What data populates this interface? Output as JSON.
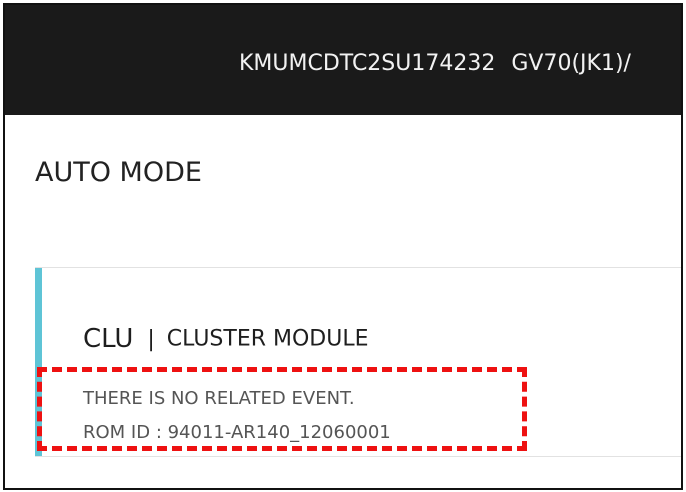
{
  "header": {
    "vin": "KMUMCDTC2SU174232",
    "model": "GV70(JK1)/"
  },
  "mode": {
    "title": "AUTO MODE"
  },
  "module": {
    "code": "CLU",
    "separator": "|",
    "name": "CLUSTER MODULE",
    "event_status": "THERE IS NO RELATED EVENT.",
    "rom_id": "ROM ID : 94011-AR140_12060001"
  },
  "colors": {
    "topbar": "#1a1a1a",
    "accent": "#5ec4d6",
    "highlight": "#ee1111"
  }
}
